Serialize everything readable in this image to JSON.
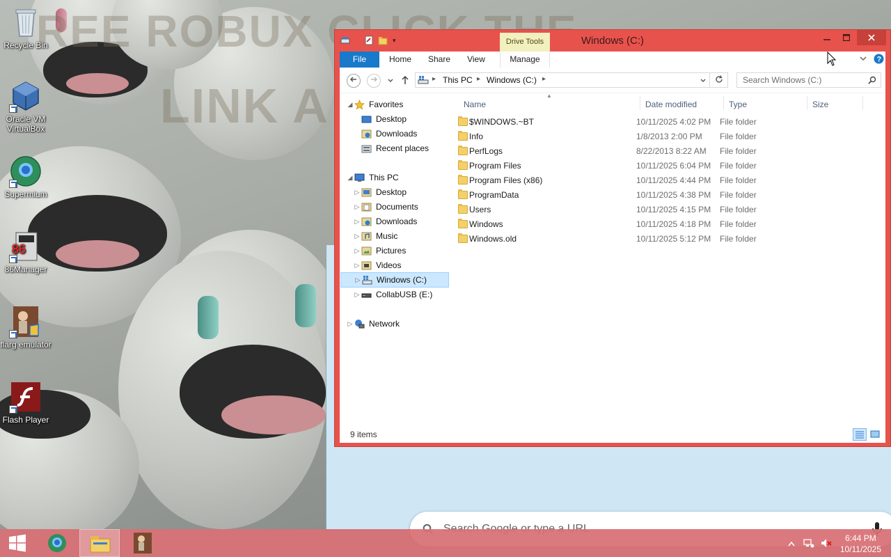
{
  "desktop": {
    "icons": [
      {
        "label": "Recycle Bin"
      },
      {
        "label": "Oracle VM VirtualBox"
      },
      {
        "label": "Supermium"
      },
      {
        "label": "86Manager"
      },
      {
        "label": "flarg emulator"
      },
      {
        "label": "Flash Player"
      }
    ]
  },
  "explorer": {
    "title": "Windows (C:)",
    "contextual_tab": "Drive Tools",
    "tabs": [
      "File",
      "Home",
      "Share",
      "View",
      "Manage"
    ],
    "address": [
      "This PC",
      "Windows (C:)"
    ],
    "search_placeholder": "Search Windows (C:)",
    "nav": {
      "favorites": {
        "label": "Favorites",
        "items": [
          "Desktop",
          "Downloads",
          "Recent places"
        ]
      },
      "this_pc": {
        "label": "This PC",
        "items": [
          "Desktop",
          "Documents",
          "Downloads",
          "Music",
          "Pictures",
          "Videos",
          "Windows (C:)",
          "CollabUSB (E:)"
        ]
      },
      "network": {
        "label": "Network"
      }
    },
    "columns": {
      "name": "Name",
      "date": "Date modified",
      "type": "Type",
      "size": "Size"
    },
    "files": [
      {
        "name": "$WINDOWS.~BT",
        "date": "10/11/2025 4:02 PM",
        "type": "File folder"
      },
      {
        "name": "Info",
        "date": "1/8/2013 2:00 PM",
        "type": "File folder"
      },
      {
        "name": "PerfLogs",
        "date": "8/22/2013 8:22 AM",
        "type": "File folder"
      },
      {
        "name": "Program Files",
        "date": "10/11/2025 6:04 PM",
        "type": "File folder"
      },
      {
        "name": "Program Files (x86)",
        "date": "10/11/2025 4:44 PM",
        "type": "File folder"
      },
      {
        "name": "ProgramData",
        "date": "10/11/2025 4:38 PM",
        "type": "File folder"
      },
      {
        "name": "Users",
        "date": "10/11/2025 4:15 PM",
        "type": "File folder"
      },
      {
        "name": "Windows",
        "date": "10/11/2025 4:18 PM",
        "type": "File folder"
      },
      {
        "name": "Windows.old",
        "date": "10/11/2025 5:12 PM",
        "type": "File folder"
      }
    ],
    "status": "9 items"
  },
  "browser": {
    "search_placeholder": "Search Google or type a URL"
  },
  "taskbar": {
    "time": "6:44 PM",
    "date": "10/11/2025"
  },
  "colors": {
    "window_frame": "#e8524c",
    "file_tab": "#1979ca",
    "drive_tools": "#f3f0c0",
    "taskbar": "#d87074",
    "selection": "#cce8ff"
  }
}
